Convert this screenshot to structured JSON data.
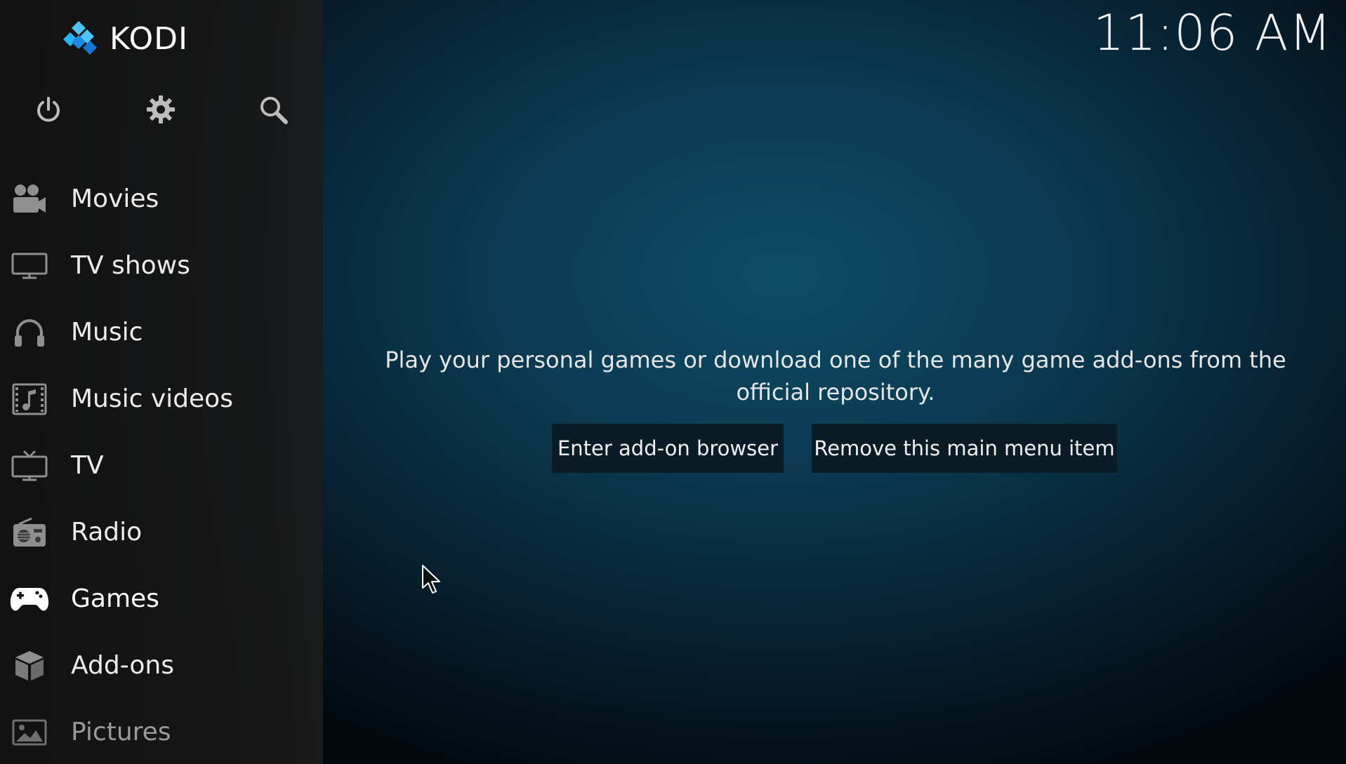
{
  "app": {
    "logo_text": "KODI",
    "clock": "11:06 AM"
  },
  "top_icons": [
    {
      "name": "power-icon"
    },
    {
      "name": "settings-icon"
    },
    {
      "name": "search-icon"
    }
  ],
  "menu": {
    "items": [
      {
        "label": "Movies",
        "icon": "movies-icon"
      },
      {
        "label": "TV shows",
        "icon": "tv-shows-icon"
      },
      {
        "label": "Music",
        "icon": "music-icon"
      },
      {
        "label": "Music videos",
        "icon": "music-videos-icon"
      },
      {
        "label": "TV",
        "icon": "tv-icon"
      },
      {
        "label": "Radio",
        "icon": "radio-icon"
      },
      {
        "label": "Games",
        "icon": "games-icon",
        "active": true
      },
      {
        "label": "Add-ons",
        "icon": "addons-icon"
      },
      {
        "label": "Pictures",
        "icon": "pictures-icon"
      }
    ]
  },
  "main": {
    "message": "Play your personal games or download one of the many game add-ons from the official repository.",
    "buttons": {
      "browser": "Enter add-on browser",
      "remove": "Remove this main menu item"
    }
  },
  "colors": {
    "logo_light": "#4fc3f7",
    "logo_dark": "#1e88e5",
    "icon_gray": "#9e9e9e",
    "button_bg": "#0a1d27"
  }
}
